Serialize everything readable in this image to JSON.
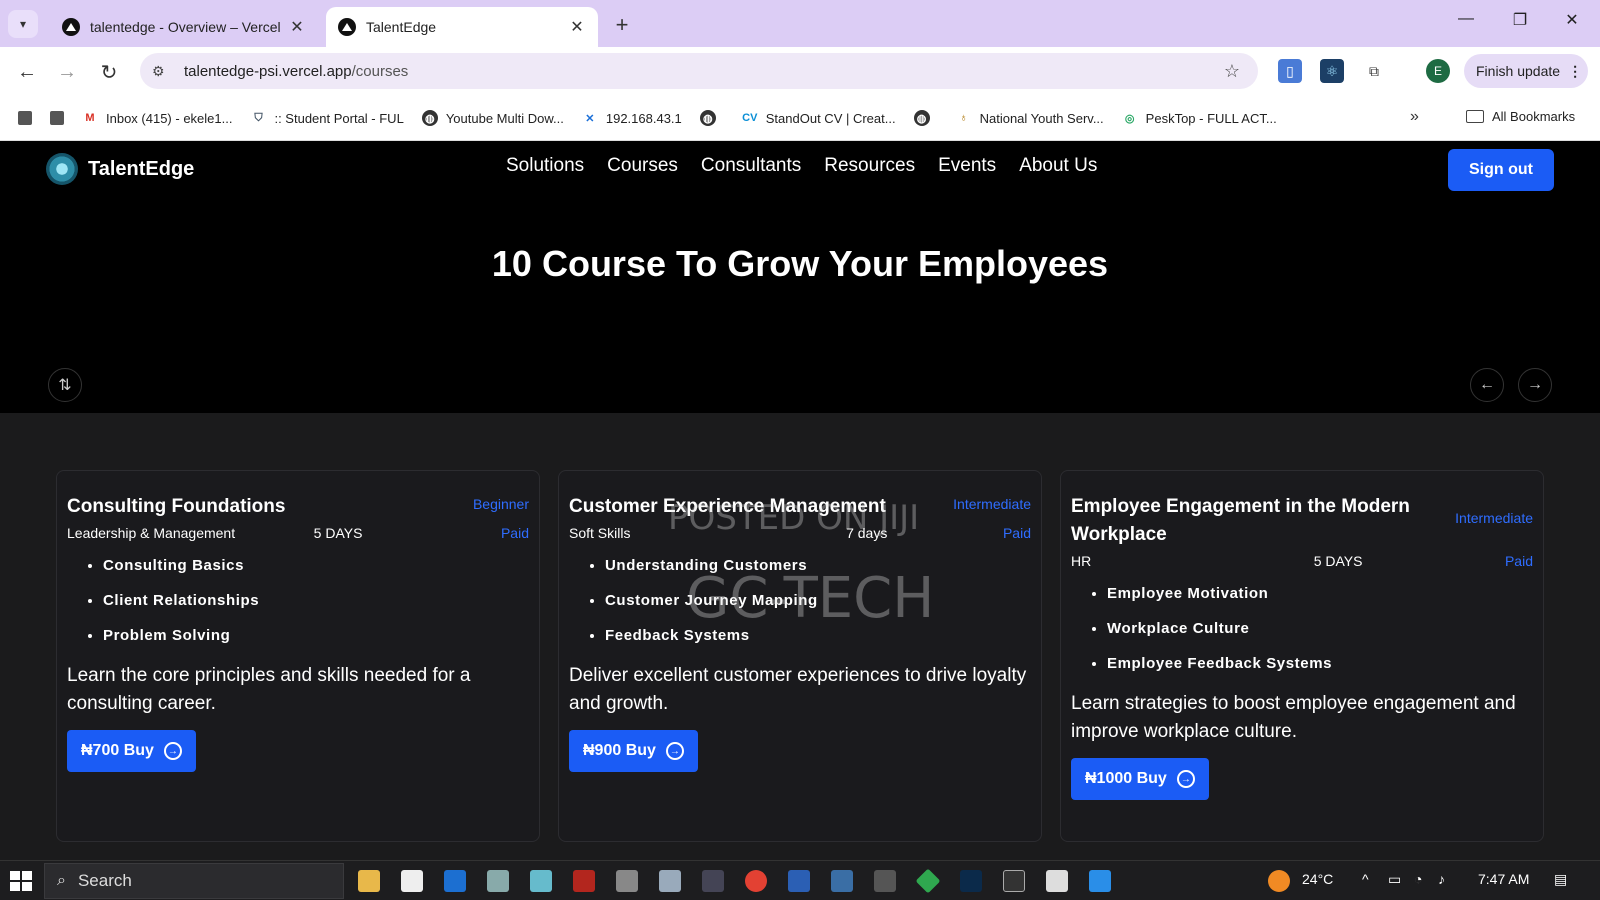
{
  "browser": {
    "tabs": [
      {
        "title": "talentedge - Overview – Vercel"
      },
      {
        "title": "TalentEdge"
      }
    ],
    "url_host": "talentedge-psi.vercel.app",
    "url_path": "/courses",
    "profile_initial": "E",
    "finish_update_label": "Finish update",
    "bookmarks": [
      {
        "label": "Inbox (415) - ekele1..."
      },
      {
        "label": ":: Student Portal - FUL"
      },
      {
        "label": "Youtube Multi Dow..."
      },
      {
        "label": "192.168.43.1"
      },
      {
        "label": "StandOut CV | Creat..."
      },
      {
        "label": "National Youth Serv..."
      },
      {
        "label": "PeskTop - FULL ACT..."
      }
    ],
    "all_bookmarks_label": "All Bookmarks"
  },
  "site": {
    "logo_text": "TalentEdge",
    "nav": [
      "Solutions",
      "Courses",
      "Consultants",
      "Resources",
      "Events",
      "About Us"
    ],
    "signout_label": "Sign out",
    "hero_title": "10 Course To Grow Your Employees"
  },
  "courses": [
    {
      "title": "Consulting Foundations",
      "level": "Beginner",
      "category": "Leadership & Management",
      "duration": "5 DAYS",
      "pricing": "Paid",
      "topics": [
        "Consulting Basics",
        "Client Relationships",
        "Problem Solving"
      ],
      "description": "Learn the core principles and skills needed for a consulting career.",
      "buy_label": "₦700 Buy"
    },
    {
      "title": "Customer Experience Management",
      "level": "Intermediate",
      "category": "Soft Skills",
      "duration": "7 days",
      "pricing": "Paid",
      "topics": [
        "Understanding Customers",
        "Customer Journey Mapping",
        "Feedback Systems"
      ],
      "description": "Deliver excellent customer experiences to drive loyalty and growth.",
      "buy_label": "₦900 Buy"
    },
    {
      "title": "Employee Engagement in the Modern Workplace",
      "level": "Intermediate",
      "category": "HR",
      "duration": "5 DAYS",
      "pricing": "Paid",
      "topics": [
        "Employee Motivation",
        "Workplace Culture",
        "Employee Feedback Systems"
      ],
      "description": "Learn strategies to boost employee engagement and improve workplace culture.",
      "buy_label": "₦1000 Buy"
    }
  ],
  "watermark": {
    "line1": "POSTED ON JIJI",
    "line2": "GC-TECH"
  },
  "taskbar": {
    "search_placeholder": "Search",
    "weather": "24°C",
    "time": "7:47 AM"
  },
  "colors": {
    "accent": "#1b5cf5",
    "level_text": "#2f6dff",
    "tab_strip": "#dccdf5"
  }
}
